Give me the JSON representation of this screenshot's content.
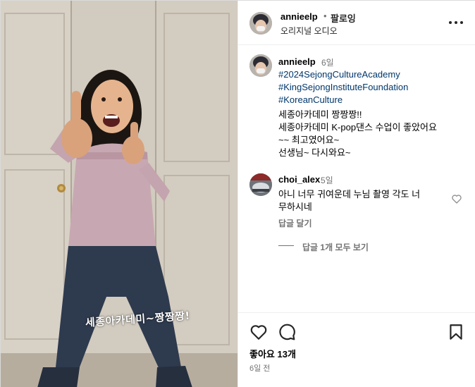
{
  "post": {
    "overlay_text": "세종아카데미~짱짱짱!"
  },
  "header": {
    "username": "annieelp",
    "separator": "•",
    "follow_label": "팔로잉",
    "audio_label": "오리지널 오디오",
    "more_icon": "more-horizontal-icon"
  },
  "caption": {
    "username": "annieelp",
    "time": "6일",
    "hashtags": [
      "#2024SejongCultureAcademy",
      "#KingSejongInstituteFoundation",
      "#KoreanCulture"
    ],
    "lines": [
      "세종아카데미 짱짱짱!!",
      "세종아카데미 K-pop댄스 수업이 좋았어요",
      "~~ 최고였어요~",
      "선생님~ 다시와요~"
    ]
  },
  "comment": {
    "username": "choi_alex",
    "time": "5일",
    "lines": [
      "아니 너무 귀여운데 누님 촬영 각도 너",
      "무하시네"
    ],
    "reply_label": "답글 달기",
    "view_replies_label": "답글 1개 모두 보기",
    "like_icon": "heart-outline-icon"
  },
  "footer": {
    "likes_label": "좋아요 13개",
    "date_label": "6일 전",
    "icons": [
      "heart-outline-icon",
      "comment-icon",
      "bookmark-icon"
    ]
  },
  "colors": {
    "hashtag": "#00376b",
    "secondary_text": "#737373",
    "border": "#dbdbdb"
  }
}
